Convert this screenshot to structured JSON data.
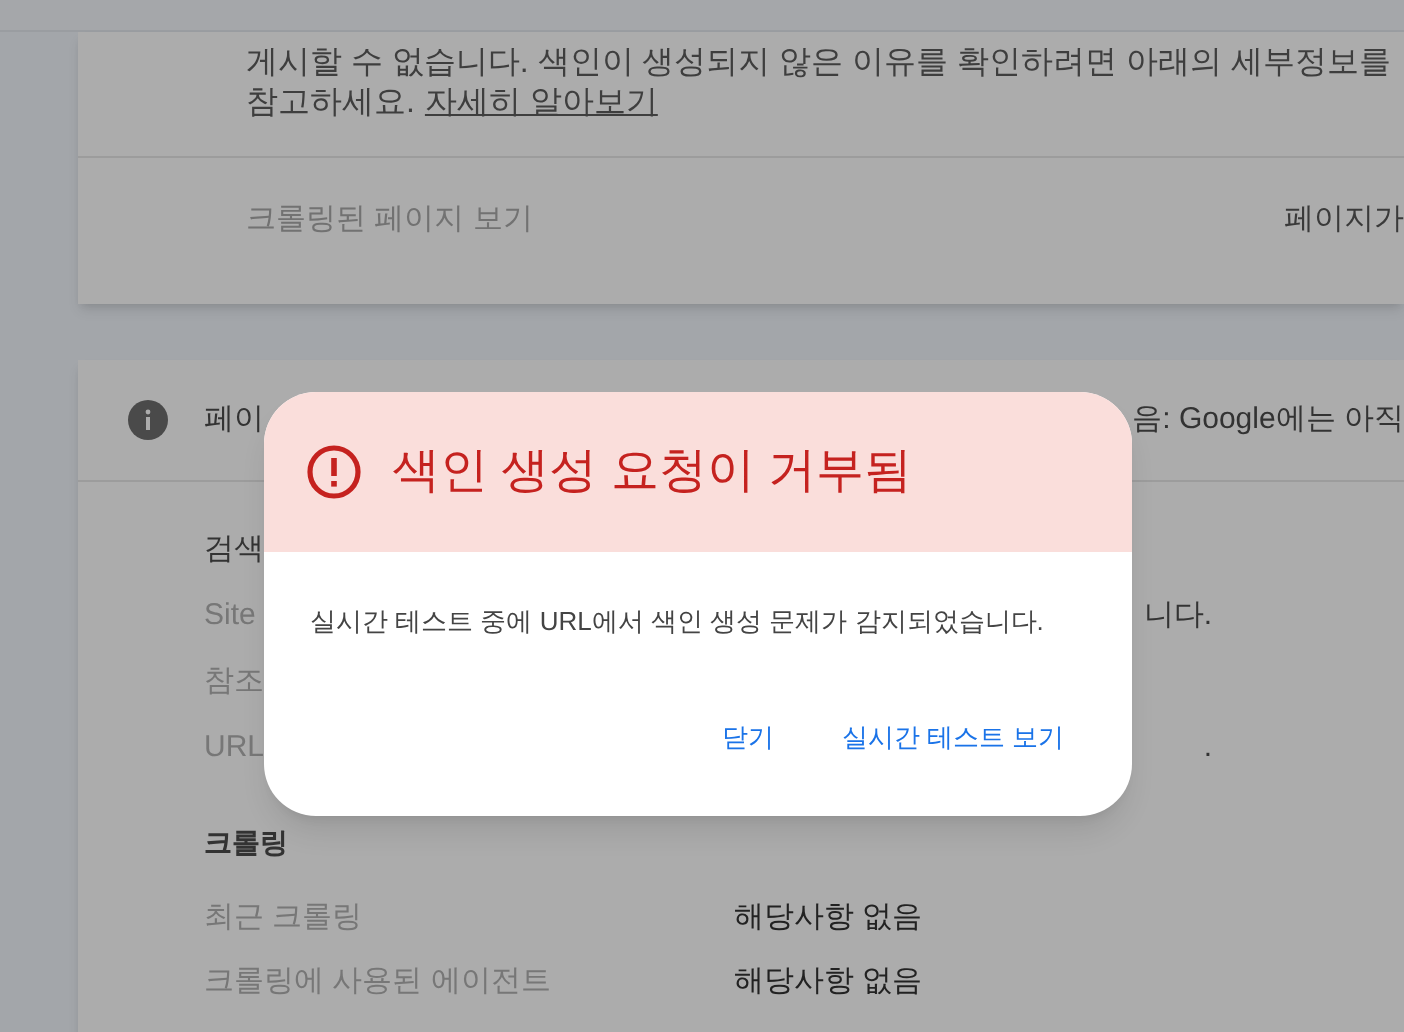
{
  "summary_card": {
    "lines": [
      "게시할 수 없습니다. 색인이 생성되지 않은 이유를 확인하려면 아래의 세부정보를",
      "참고하세요."
    ],
    "link": "자세히 알아보기",
    "footer_left": "크롤링된 페이지 보기",
    "footer_right": "페이지가"
  },
  "detail_card": {
    "header_left": "페이",
    "header_right": "음: Google에는 아직",
    "section_fragment": "검색",
    "rows": [
      {
        "label": "Site",
        "value": "니다."
      },
      {
        "label": "참조",
        "value": ""
      },
      {
        "label": "URL",
        "value": "."
      }
    ],
    "crawl_title": "크롤링",
    "crawl_rows": [
      {
        "label": "최근 크롤링",
        "value": "해당사항 없음"
      },
      {
        "label": "크롤링에 사용된 에이전트",
        "value": "해당사항 없음"
      }
    ]
  },
  "dialog": {
    "title": "색인 생성 요청이 거부됨",
    "message": "실시간 테스트 중에 URL에서 색인 생성 문제가 감지되었습니다.",
    "buttons": [
      "닫기",
      "실시간 테스트 보기"
    ]
  }
}
